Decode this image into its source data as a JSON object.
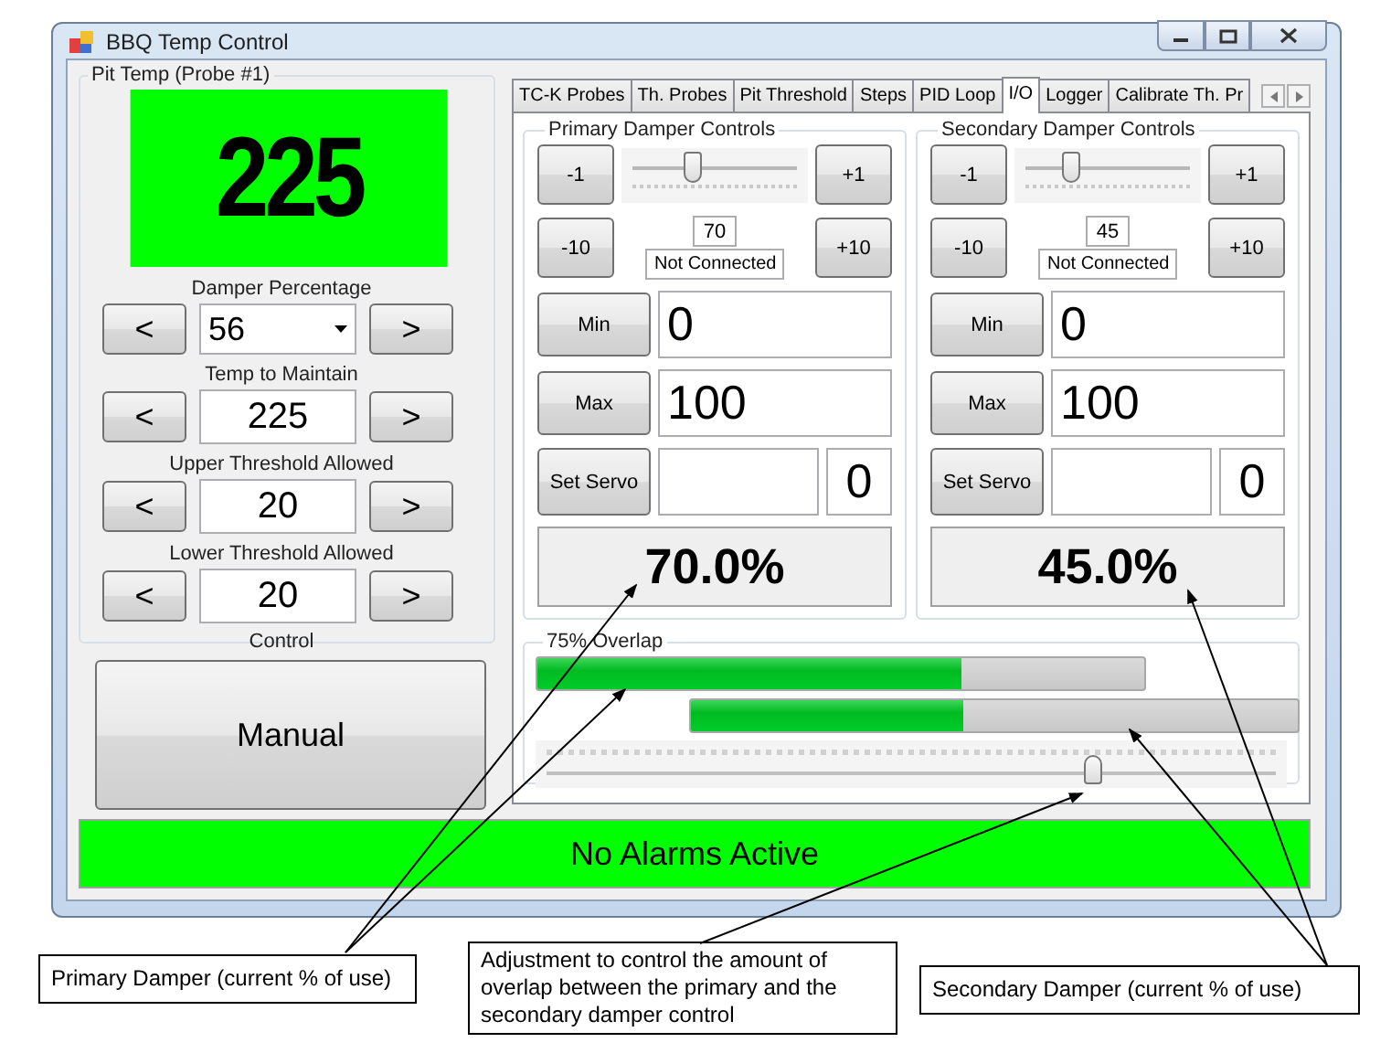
{
  "window": {
    "title": "BBQ Temp Control"
  },
  "pit_temp": {
    "title": "Pit Temp (Probe #1)",
    "reading": "225"
  },
  "setpoints": [
    {
      "kind": "dropdown",
      "label": "Damper Percentage",
      "value": "56",
      "decrease": "<",
      "increase": ">"
    },
    {
      "kind": "field",
      "label": "Temp to Maintain",
      "value": "225",
      "decrease": "<",
      "increase": ">"
    },
    {
      "kind": "field",
      "label": "Upper Threshold Allowed",
      "value": "20",
      "decrease": "<",
      "increase": ">"
    },
    {
      "kind": "field",
      "label": "Lower Threshold Allowed",
      "value": "20",
      "decrease": "<",
      "increase": ">"
    }
  ],
  "control": {
    "label": "Control",
    "button": "Manual"
  },
  "tabs": [
    {
      "label": "TC-K Probes",
      "selected": false
    },
    {
      "label": "Th. Probes",
      "selected": false
    },
    {
      "label": "Pit Threshold",
      "selected": false
    },
    {
      "label": "Steps",
      "selected": false
    },
    {
      "label": "PID Loop",
      "selected": false
    },
    {
      "label": "I/O",
      "selected": true
    },
    {
      "label": "Logger",
      "selected": false
    },
    {
      "label": "Calibrate Th. Pr",
      "selected": false
    }
  ],
  "dampers": [
    {
      "title": "Primary Damper Controls",
      "minus_1": "-1",
      "plus_1": "+1",
      "minus_10": "-10",
      "plus_10": "+10",
      "slider": {
        "level": 0.37
      },
      "value": "70",
      "status": "Not Connected",
      "min_button": "Min",
      "min_value": "0",
      "max_button": "Max",
      "max_value": "100",
      "servo_button": "Set Servo",
      "servo_value": "0",
      "percent": "70.0%"
    },
    {
      "title": "Secondary Damper Controls",
      "minus_1": "-1",
      "plus_1": "+1",
      "minus_10": "-10",
      "plus_10": "+10",
      "slider": {
        "level": 0.28
      },
      "value": "45",
      "status": "Not Connected",
      "min_button": "Min",
      "min_value": "0",
      "max_button": "Max",
      "max_value": "100",
      "servo_button": "Set Servo",
      "servo_value": "0",
      "percent": "45.0%"
    }
  ],
  "overlap": {
    "title": "75% Overlap",
    "bars": [
      {
        "level": 0.7
      },
      {
        "level": 0.45
      }
    ],
    "slider": {
      "level": 0.75
    }
  },
  "status_bar": {
    "text": "No Alarms Active"
  },
  "callouts": [
    {
      "text": "Primary Damper (current % of use)"
    },
    {
      "text": "Adjustment to control the amount of overlap between the primary and the secondary damper control"
    },
    {
      "text": "Secondary Damper (current % of use)"
    }
  ]
}
